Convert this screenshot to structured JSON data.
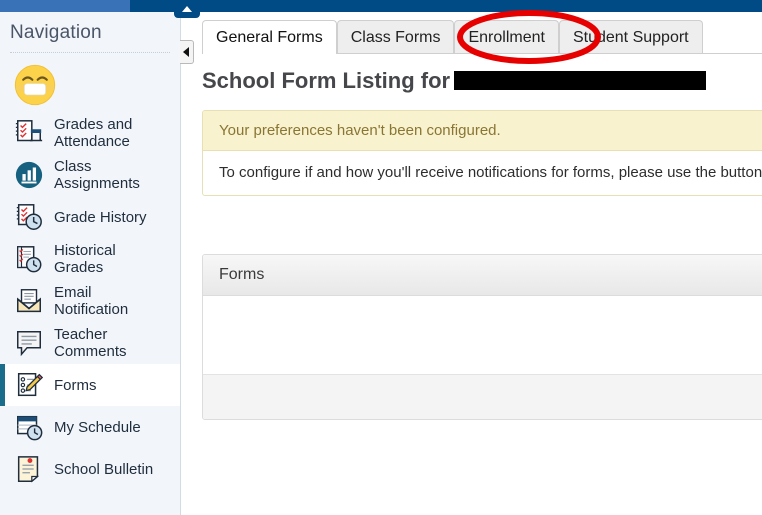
{
  "theme": {
    "topbar_navy": "#004a85",
    "topbar_blue": "#3a72b8",
    "sidebar_bg": "#f2f6fa",
    "active_accent": "#1b6d8c",
    "alert_bg": "#f8f2cf",
    "alert_border": "#e8dfb4",
    "annotation_red": "#e60000"
  },
  "sidebar": {
    "title": "Navigation",
    "avatar_icon": "masked-face-emoji-avatar",
    "items": [
      {
        "label": "Grades and Attendance",
        "icon": "grades-attendance-icon",
        "active": false
      },
      {
        "label": "Class Assignments",
        "icon": "class-assignments-chart-icon",
        "active": false
      },
      {
        "label": "Grade History",
        "icon": "grade-history-clock-icon",
        "active": false
      },
      {
        "label": "Historical Grades",
        "icon": "historical-grades-notebook-icon",
        "active": false
      },
      {
        "label": "Email Notification",
        "icon": "email-notification-envelope-icon",
        "active": false
      },
      {
        "label": "Teacher Comments",
        "icon": "teacher-comments-speech-icon",
        "active": false
      },
      {
        "label": "Forms",
        "icon": "forms-checklist-pencil-icon",
        "active": true
      },
      {
        "label": "My Schedule",
        "icon": "my-schedule-calendar-clock-icon",
        "active": false
      },
      {
        "label": "School Bulletin",
        "icon": "school-bulletin-document-icon",
        "active": false
      }
    ],
    "collapse_icon": "chevron-left-icon",
    "scroll_top_icon": "chevron-up-icon"
  },
  "main": {
    "tabs": [
      {
        "label": "General Forms",
        "active": true
      },
      {
        "label": "Class Forms",
        "active": false
      },
      {
        "label": "Enrollment",
        "active": false
      },
      {
        "label": "Student Support",
        "active": false
      }
    ],
    "page_title_prefix": "School Form Listing for",
    "page_title_redacted": true,
    "alert": {
      "heading": "Your preferences haven't been configured.",
      "body": "To configure if and how you'll receive notifications for forms, please use the button belo"
    },
    "forms_panel": {
      "header": "Forms",
      "rows": []
    }
  },
  "annotation": {
    "shape": "ellipse",
    "target_tab": "Enrollment",
    "color": "#e60000"
  }
}
